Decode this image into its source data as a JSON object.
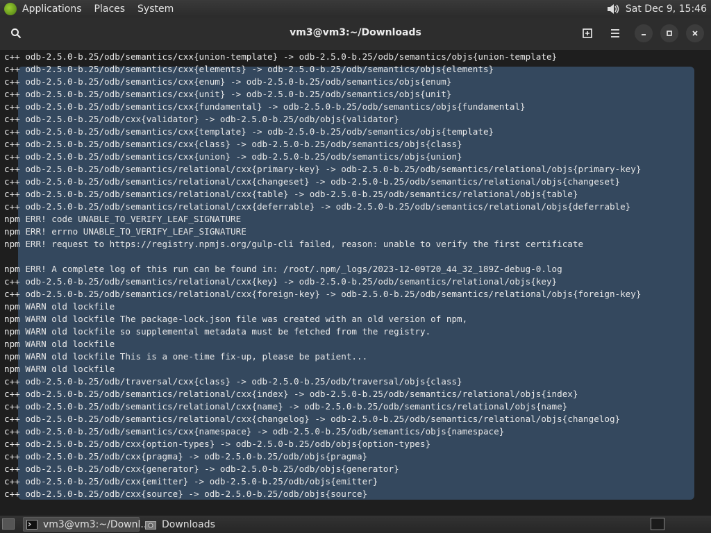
{
  "top_panel": {
    "menus": [
      "Applications",
      "Places",
      "System"
    ],
    "clock": "Sat Dec 9, 15:46",
    "icons": [
      "gnome-foot-logo-icon",
      "volume-icon"
    ]
  },
  "window": {
    "title": "vm3@vm3:~/Downloads",
    "buttons": [
      "search-icon",
      "new-tab-icon",
      "menu-icon",
      "minimize-icon",
      "maximize-icon",
      "close-icon"
    ]
  },
  "terminal": {
    "selection_color": "#34485e",
    "lines": [
      "c++ odb-2.5.0-b.25/odb/semantics/cxx{union-template} -> odb-2.5.0-b.25/odb/semantics/objs{union-template}",
      "c++ odb-2.5.0-b.25/odb/semantics/cxx{elements} -> odb-2.5.0-b.25/odb/semantics/objs{elements}",
      "c++ odb-2.5.0-b.25/odb/semantics/cxx{enum} -> odb-2.5.0-b.25/odb/semantics/objs{enum}",
      "c++ odb-2.5.0-b.25/odb/semantics/cxx{unit} -> odb-2.5.0-b.25/odb/semantics/objs{unit}",
      "c++ odb-2.5.0-b.25/odb/semantics/cxx{fundamental} -> odb-2.5.0-b.25/odb/semantics/objs{fundamental}",
      "c++ odb-2.5.0-b.25/odb/cxx{validator} -> odb-2.5.0-b.25/odb/objs{validator}",
      "c++ odb-2.5.0-b.25/odb/semantics/cxx{template} -> odb-2.5.0-b.25/odb/semantics/objs{template}",
      "c++ odb-2.5.0-b.25/odb/semantics/cxx{class} -> odb-2.5.0-b.25/odb/semantics/objs{class}",
      "c++ odb-2.5.0-b.25/odb/semantics/cxx{union} -> odb-2.5.0-b.25/odb/semantics/objs{union}",
      "c++ odb-2.5.0-b.25/odb/semantics/relational/cxx{primary-key} -> odb-2.5.0-b.25/odb/semantics/relational/objs{primary-key}",
      "c++ odb-2.5.0-b.25/odb/semantics/relational/cxx{changeset} -> odb-2.5.0-b.25/odb/semantics/relational/objs{changeset}",
      "c++ odb-2.5.0-b.25/odb/semantics/relational/cxx{table} -> odb-2.5.0-b.25/odb/semantics/relational/objs{table}",
      "c++ odb-2.5.0-b.25/odb/semantics/relational/cxx{deferrable} -> odb-2.5.0-b.25/odb/semantics/relational/objs{deferrable}",
      "npm ERR! code UNABLE_TO_VERIFY_LEAF_SIGNATURE",
      "npm ERR! errno UNABLE_TO_VERIFY_LEAF_SIGNATURE",
      "npm ERR! request to https://registry.npmjs.org/gulp-cli failed, reason: unable to verify the first certificate",
      "",
      "npm ERR! A complete log of this run can be found in: /root/.npm/_logs/2023-12-09T20_44_32_189Z-debug-0.log",
      "c++ odb-2.5.0-b.25/odb/semantics/relational/cxx{key} -> odb-2.5.0-b.25/odb/semantics/relational/objs{key}",
      "c++ odb-2.5.0-b.25/odb/semantics/relational/cxx{foreign-key} -> odb-2.5.0-b.25/odb/semantics/relational/objs{foreign-key}",
      "npm WARN old lockfile",
      "npm WARN old lockfile The package-lock.json file was created with an old version of npm,",
      "npm WARN old lockfile so supplemental metadata must be fetched from the registry.",
      "npm WARN old lockfile",
      "npm WARN old lockfile This is a one-time fix-up, please be patient...",
      "npm WARN old lockfile",
      "c++ odb-2.5.0-b.25/odb/traversal/cxx{class} -> odb-2.5.0-b.25/odb/traversal/objs{class}",
      "c++ odb-2.5.0-b.25/odb/semantics/relational/cxx{index} -> odb-2.5.0-b.25/odb/semantics/relational/objs{index}",
      "c++ odb-2.5.0-b.25/odb/semantics/relational/cxx{name} -> odb-2.5.0-b.25/odb/semantics/relational/objs{name}",
      "c++ odb-2.5.0-b.25/odb/semantics/relational/cxx{changelog} -> odb-2.5.0-b.25/odb/semantics/relational/objs{changelog}",
      "c++ odb-2.5.0-b.25/odb/semantics/cxx{namespace} -> odb-2.5.0-b.25/odb/semantics/objs{namespace}",
      "c++ odb-2.5.0-b.25/odb/cxx{option-types} -> odb-2.5.0-b.25/odb/objs{option-types}",
      "c++ odb-2.5.0-b.25/odb/cxx{pragma} -> odb-2.5.0-b.25/odb/objs{pragma}",
      "c++ odb-2.5.0-b.25/odb/cxx{generator} -> odb-2.5.0-b.25/odb/objs{generator}",
      "c++ odb-2.5.0-b.25/odb/cxx{emitter} -> odb-2.5.0-b.25/odb/objs{emitter}",
      "c++ odb-2.5.0-b.25/odb/cxx{source} -> odb-2.5.0-b.25/odb/objs{source}"
    ]
  },
  "taskbar": {
    "tasks": [
      {
        "label": "vm3@vm3:~/Downl...",
        "icon": "terminal-icon"
      },
      {
        "label": "Downloads",
        "icon": "file-manager-icon"
      }
    ]
  }
}
